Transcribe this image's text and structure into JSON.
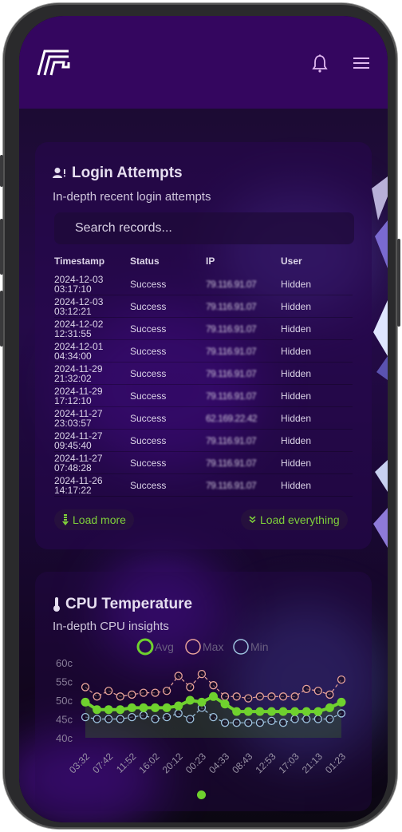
{
  "header": {
    "logo": "logo-icon",
    "notifications_icon": "bell-icon",
    "menu_icon": "hamburger-menu-icon"
  },
  "login_card": {
    "icon": "user-alert-icon",
    "title": "Login Attempts",
    "subtitle": "In-depth recent login attempts",
    "search_placeholder": "Search records...",
    "columns": [
      "Timestamp",
      "Status",
      "IP",
      "User"
    ],
    "rows": [
      {
        "date": "2024-12-03",
        "time": "03:17:10",
        "status": "Success",
        "ip": "79.116.91.07",
        "user": "Hidden"
      },
      {
        "date": "2024-12-03",
        "time": "03:12:21",
        "status": "Success",
        "ip": "79.116.91.07",
        "user": "Hidden"
      },
      {
        "date": "2024-12-02",
        "time": "12:31:55",
        "status": "Success",
        "ip": "79.116.91.07",
        "user": "Hidden"
      },
      {
        "date": "2024-12-01",
        "time": "04:34:00",
        "status": "Success",
        "ip": "79.116.91.07",
        "user": "Hidden"
      },
      {
        "date": "2024-11-29",
        "time": "21:32:02",
        "status": "Success",
        "ip": "79.116.91.07",
        "user": "Hidden"
      },
      {
        "date": "2024-11-29",
        "time": "17:12:10",
        "status": "Success",
        "ip": "79.116.91.07",
        "user": "Hidden"
      },
      {
        "date": "2024-11-27",
        "time": "23:03:57",
        "status": "Success",
        "ip": "62.169.22.42",
        "user": "Hidden"
      },
      {
        "date": "2024-11-27",
        "time": "09:45:40",
        "status": "Success",
        "ip": "79.116.91.07",
        "user": "Hidden"
      },
      {
        "date": "2024-11-27",
        "time": "07:48:28",
        "status": "Success",
        "ip": "79.116.91.07",
        "user": "Hidden"
      },
      {
        "date": "2024-11-26",
        "time": "14:17:22",
        "status": "Success",
        "ip": "79.116.91.07",
        "user": "Hidden"
      }
    ],
    "load_more_label": "Load more",
    "load_everything_label": "Load everything"
  },
  "cpu_card": {
    "icon": "thermometer-icon",
    "title": "CPU Temperature",
    "subtitle": "In-depth CPU insights"
  },
  "colors": {
    "accent_green": "#6fd12e",
    "max_series": "#e8a39a",
    "min_series": "#9ec3df",
    "header_bg": "#34065f"
  },
  "pagination": {
    "pages": 1,
    "active": 1
  },
  "chart_data": {
    "type": "line",
    "title": "CPU Temperature",
    "legend": [
      "Avg",
      "Max",
      "Min"
    ],
    "legend_position": "top-center",
    "ylim": [
      40,
      60
    ],
    "yticks": [
      "40c",
      "45c",
      "50c",
      "55c",
      "60c"
    ],
    "xticks": [
      "03:32",
      "07:42",
      "11:52",
      "16:02",
      "20:12",
      "00:23",
      "04:33",
      "08:43",
      "12:53",
      "17:03",
      "21:13",
      "01:23"
    ],
    "series": [
      {
        "name": "Avg",
        "values": [
          49.5,
          47.5,
          47.5,
          47.5,
          48,
          48,
          48,
          48,
          48.5,
          50,
          49.5,
          51,
          49,
          47,
          47,
          47,
          47,
          47,
          47,
          47,
          47,
          48,
          49.5
        ]
      },
      {
        "name": "Max",
        "values": [
          53.5,
          51,
          52.5,
          51,
          51.5,
          52,
          52,
          52.5,
          56.5,
          53.5,
          57,
          54,
          51,
          51,
          50.5,
          51,
          51,
          51,
          51,
          53,
          52.5,
          51.5,
          55.5
        ]
      },
      {
        "name": "Min",
        "values": [
          45.5,
          45,
          45,
          45,
          45.5,
          46,
          45,
          45.5,
          46.5,
          45,
          48,
          45.5,
          44,
          44,
          44,
          44,
          44.5,
          44,
          45,
          45,
          45,
          45,
          46.5
        ]
      }
    ]
  }
}
